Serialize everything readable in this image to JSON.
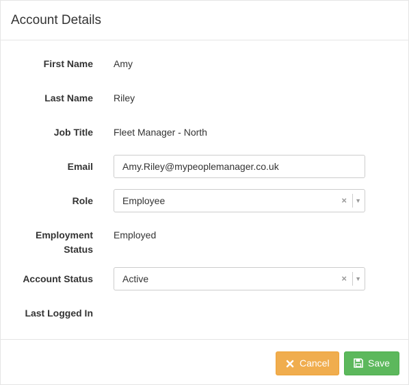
{
  "modal": {
    "title": "Account Details"
  },
  "fields": {
    "first_name": {
      "label": "First Name",
      "value": "Amy"
    },
    "last_name": {
      "label": "Last Name",
      "value": "Riley"
    },
    "job_title": {
      "label": "Job Title",
      "value": "Fleet Manager - North"
    },
    "email": {
      "label": "Email",
      "value": "Amy.Riley@mypeoplemanager.co.uk"
    },
    "role": {
      "label": "Role",
      "value": "Employee"
    },
    "employment_status": {
      "label_line1": "Employment",
      "label_line2": "Status",
      "value": "Employed"
    },
    "account_status": {
      "label": "Account Status",
      "value": "Active"
    },
    "last_logged_in": {
      "label": "Last Logged In",
      "value": ""
    }
  },
  "select_controls": {
    "clear_glyph": "×",
    "arrow_glyph": "▼"
  },
  "footer": {
    "cancel_label": "Cancel",
    "save_label": "Save"
  },
  "colors": {
    "cancel": "#f0ad4e",
    "save": "#5cb85c",
    "border": "#e5e5e5"
  },
  "icons": {
    "cancel": "close-icon",
    "save": "floppy-disk-icon"
  }
}
